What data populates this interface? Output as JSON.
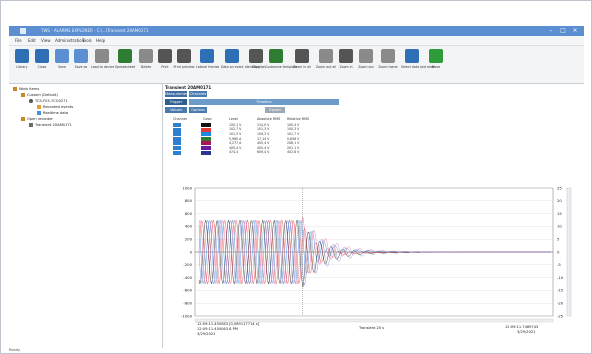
{
  "window": {
    "title": "TWS - ALARMS EXPLORER - C:\\...\\Transient 20AM0171",
    "controls": [
      "–",
      "□",
      "×"
    ]
  },
  "menu": [
    "File",
    "Edit",
    "View",
    "Administration",
    "Tools",
    "Help"
  ],
  "toolbar": [
    {
      "label": "Library",
      "color": "#2f6fb6"
    },
    {
      "label": "Close",
      "color": "#2f6fb6"
    },
    {
      "label": "Save",
      "color": "#5b8fd1"
    },
    {
      "label": "Save as",
      "color": "#5b8fd1"
    },
    {
      "label": "Load to device",
      "color": "#8a8a8a"
    },
    {
      "label": "Spreadsheet",
      "color": "#2e7d32"
    },
    {
      "label": "Delete",
      "color": "#8a8a8a"
    },
    {
      "label": "Print",
      "color": "#555555"
    },
    {
      "label": "Print preview",
      "color": "#555555"
    },
    {
      "label": "Lateral frames",
      "color": "#2f6fb6"
    },
    {
      "label": "Data on event identification",
      "color": "#2f6fb6"
    },
    {
      "label": "Copy",
      "color": "#555555"
    },
    {
      "label": "Customize template",
      "color": "#2e7d32"
    },
    {
      "label": "Zoom in all",
      "color": "#555555"
    },
    {
      "label": "Zoom out all",
      "color": "#8a8a8a"
    },
    {
      "label": "Zoom in",
      "color": "#555555"
    },
    {
      "label": "Zoom out",
      "color": "#8a8a8a"
    },
    {
      "label": "Zoom home",
      "color": "#8a8a8a"
    },
    {
      "label": "Select data and area",
      "color": "#2f6fb6"
    },
    {
      "label": "Move",
      "color": "#2e9b3a"
    }
  ],
  "tree": {
    "root": "Work items",
    "items": [
      {
        "label": "Custom (Default)",
        "depth": 1
      },
      {
        "label": "TCS-F03-7CG0271",
        "depth": 2
      },
      {
        "label": "Recorded events",
        "depth": 3
      },
      {
        "label": "Realtime data",
        "depth": 3
      },
      {
        "label": "Open recorder",
        "depth": 1
      },
      {
        "label": "Transient 20AM0171",
        "depth": 2
      }
    ]
  },
  "recording": {
    "title": "Transient 20AM0171",
    "tabs": [
      "Measurements",
      "Channels",
      "Trigger setup",
      "Timeline",
      "Values",
      "Options",
      "Export"
    ],
    "table": {
      "headers": [
        "Channel",
        "Color",
        "Level",
        "Absolute RMS",
        "Relative RMS"
      ],
      "rows": [
        {
          "color": "#111111",
          "level": "100,1 V",
          "abs": "114,0 V",
          "rel": "100,4 V"
        },
        {
          "color": "#e53935",
          "level": "102,7 V",
          "abs": "101,3 V",
          "rel": "100,3 V"
        },
        {
          "color": "#1e88e5",
          "level": "101,5 V",
          "abs": "109,3 V",
          "rel": "101,7 V"
        },
        {
          "color": "#2e7d32",
          "level": "5,960 A",
          "abs": "17,14 V",
          "rel": "0,858 V"
        },
        {
          "color": "#ad1457",
          "level": "4,277 A",
          "abs": "405,4 V",
          "rel": "208,1 V"
        },
        {
          "color": "#6a1b9a",
          "level": "405,4 V",
          "abs": "405,4 V",
          "rel": "201,1 V"
        },
        {
          "color": "#283593",
          "level": "474,4",
          "abs": "609,4 V",
          "rel": "402,8 V"
        }
      ]
    }
  },
  "chart_data": {
    "type": "line",
    "y_left_ticks": [
      "1000",
      "800",
      "600",
      "400",
      "200",
      "0",
      "-200",
      "-400",
      "-600",
      "-800",
      "-1000"
    ],
    "y_right_ticks": [
      "25",
      "20",
      "15",
      "10",
      "5",
      "0",
      "-5",
      "-10",
      "-15",
      "-20",
      "-25"
    ],
    "ylim_left": [
      -1000,
      1000
    ],
    "ylim_right": [
      -25,
      25
    ],
    "series": [
      {
        "color": "#e53935",
        "phase": 0
      },
      {
        "color": "#1e88e5",
        "phase": 2.09
      },
      {
        "color": "#111111",
        "phase": 4.19
      },
      {
        "color": "#f06292",
        "phase": 1.05
      },
      {
        "color": "#7986cb",
        "phase": 3.14
      }
    ],
    "footer_left_line1": "12:09:11.450063 [0,089117714 s]",
    "footer_left_line2": "12:09:11.450063 8 PM",
    "footer_left_line3": "3/29/2021",
    "footer_mid": "Transient 20 s",
    "footer_right_line1": "12:09:11.7489743",
    "footer_right_line2": "3/29/2021"
  },
  "status": {
    "text": "Ready"
  }
}
